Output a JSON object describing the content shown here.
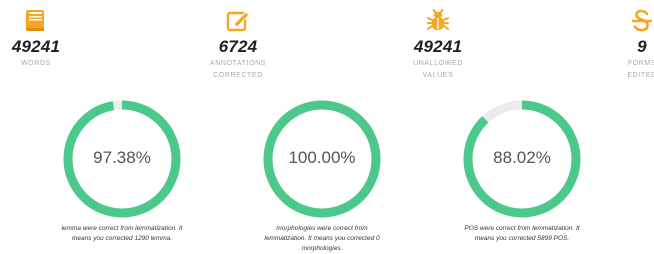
{
  "colors": {
    "accent": "#f5a623",
    "ring_fill": "#4cc88b",
    "ring_track": "#ececec"
  },
  "stats": [
    {
      "icon": "book-icon",
      "value": "49241",
      "label_lines": [
        "WORDS"
      ]
    },
    {
      "icon": "edit-icon",
      "value": "6724",
      "label_lines": [
        "ANNOTATIONS",
        "CORRECTED"
      ]
    },
    {
      "icon": "bug-icon",
      "value": "49241",
      "label_lines": [
        "UNALLOWED",
        "VALUES"
      ]
    },
    {
      "icon": "strikethrough-icon",
      "value": "9",
      "label_lines": [
        "FORMS",
        "EDITED"
      ]
    }
  ],
  "gauges": [
    {
      "percent": 97.38,
      "label": "97.38%",
      "caption_lines": [
        "lemma were correct from lemmatization. It",
        "means you corrected 1290 lemma."
      ]
    },
    {
      "percent": 100.0,
      "label": "100.00%",
      "caption_lines": [
        "morphologies were correct from",
        "lemmatization. It means you corrected 0",
        "morphologies."
      ]
    },
    {
      "percent": 88.02,
      "label": "88.02%",
      "caption_lines": [
        "POS were correct from lemmatization. It",
        "means you corrected 5899 POS."
      ]
    }
  ]
}
